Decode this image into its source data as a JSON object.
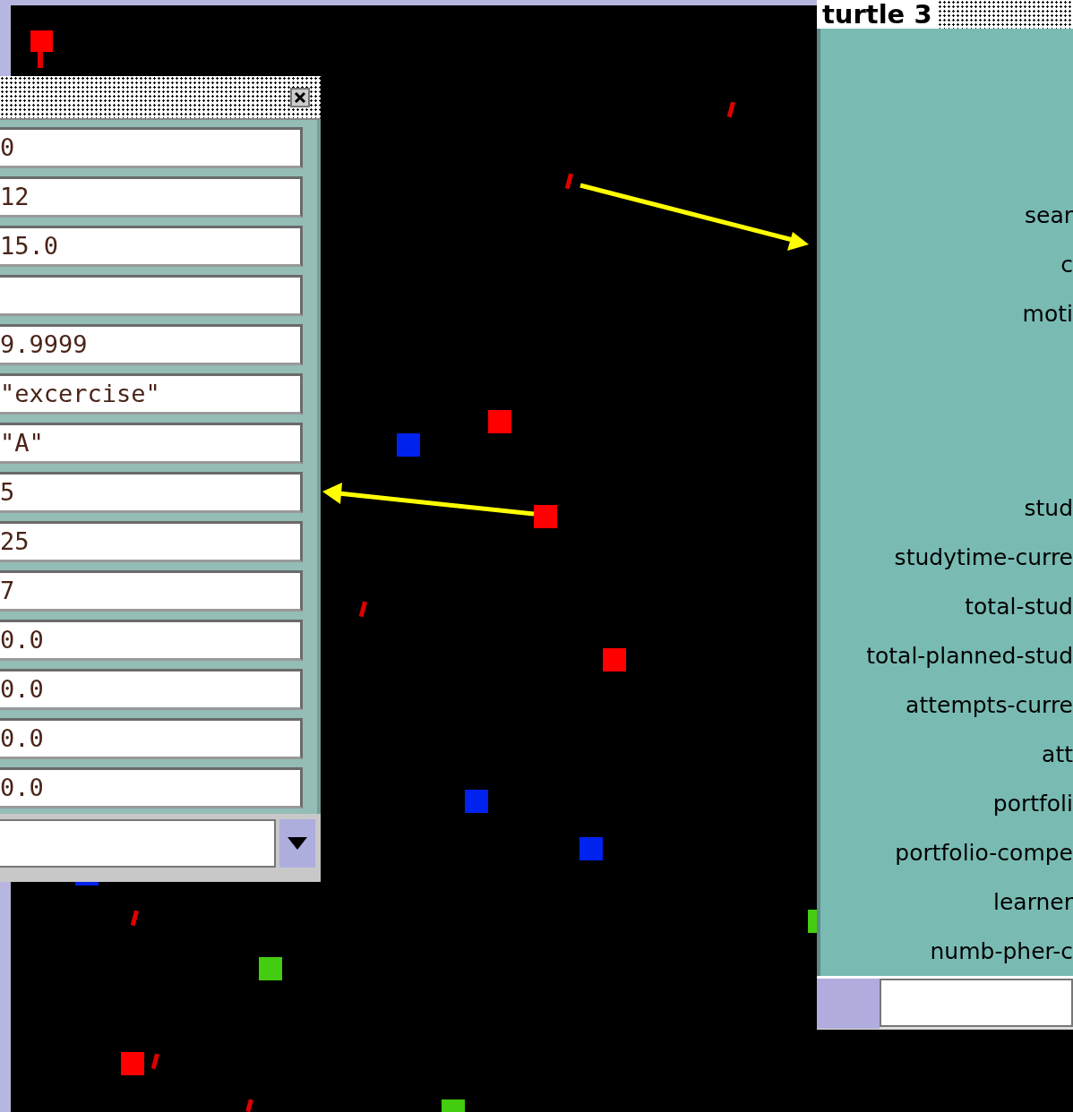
{
  "inspector_left": {
    "fields": [
      {
        "kind": "value",
        "value": "0"
      },
      {
        "kind": "value",
        "value": "12"
      },
      {
        "kind": "value",
        "value": "15.0"
      },
      {
        "kind": "blank"
      },
      {
        "kind": "value",
        "value": "9.9999"
      },
      {
        "kind": "value",
        "value": "\"excercise\""
      },
      {
        "kind": "value",
        "value": "\"A\""
      },
      {
        "kind": "value",
        "value": "5"
      },
      {
        "kind": "value",
        "value": "25"
      },
      {
        "kind": "value",
        "value": "7"
      },
      {
        "kind": "value",
        "value": "0.0"
      },
      {
        "kind": "value",
        "value": "0.0"
      },
      {
        "kind": "value",
        "value": "0.0"
      },
      {
        "kind": "value",
        "value": "0.0"
      }
    ]
  },
  "inspector_right": {
    "title": "turtle 3",
    "label_groups": [
      {
        "labels": [
          "sear",
          "c",
          "moti"
        ]
      },
      {
        "labels": [
          "stud",
          "studytime-curre",
          "total-stud",
          "total-planned-stud",
          "attempts-curre",
          "att",
          "portfoli",
          "portfolio-compe",
          "learner",
          "numb-pher-c"
        ]
      }
    ]
  }
}
